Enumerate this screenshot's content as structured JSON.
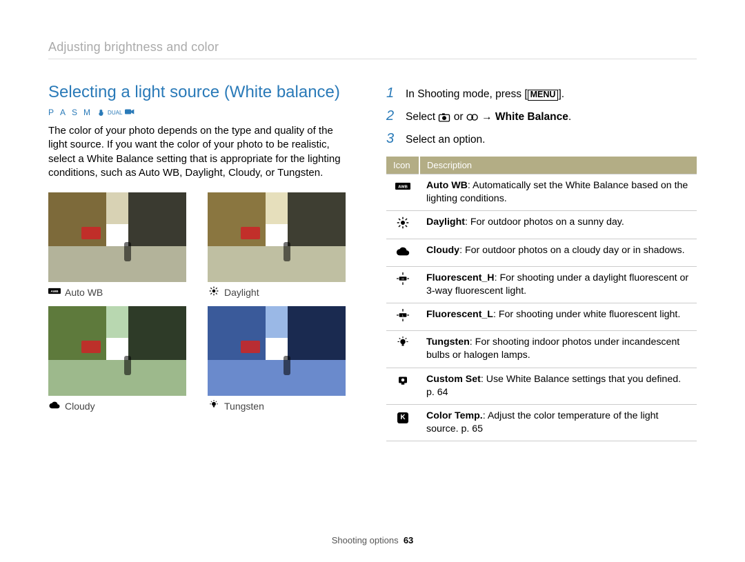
{
  "breadcrumb": "Adjusting brightness and color",
  "section_title": "Selecting a light source (White balance)",
  "modes": {
    "p": "P",
    "a": "A",
    "s": "S",
    "m": "M",
    "dual": "DUAL"
  },
  "intro": "The color of your photo depends on the type and quality of the light source. If you want the color of your photo to be realistic, select a White Balance setting that is appropriate for the lighting conditions, such as Auto WB, Daylight, Cloudy, or Tungsten.",
  "thumbs": {
    "autoWB": "Auto WB",
    "daylight": "Daylight",
    "cloudy": "Cloudy",
    "tungsten": "Tungsten"
  },
  "steps": {
    "s1_pre": "In Shooting mode, press [",
    "s1_menu": "MENU",
    "s1_post": "].",
    "s2_pre": "Select ",
    "s2_or": " or ",
    "s2_arrow": " → ",
    "s2_bold": "White Balance",
    "s2_end": ".",
    "s3": "Select an option.",
    "n1": "1",
    "n2": "2",
    "n3": "3"
  },
  "table": {
    "h_icon": "Icon",
    "h_desc": "Description",
    "rows": [
      {
        "bold": "Auto WB",
        "rest": ": Automatically set the White Balance based on the lighting conditions."
      },
      {
        "bold": "Daylight",
        "rest": ": For outdoor photos on a sunny day."
      },
      {
        "bold": "Cloudy",
        "rest": ": For outdoor photos on a cloudy day or in shadows."
      },
      {
        "bold": "Fluorescent_H",
        "rest": ": For shooting under a daylight fluorescent or 3-way fluorescent light."
      },
      {
        "bold": "Fluorescent_L",
        "rest": ": For shooting under white fluorescent light."
      },
      {
        "bold": "Tungsten",
        "rest": ": For shooting indoor photos under incandescent bulbs or halogen lamps."
      },
      {
        "bold": "Custom Set",
        "rest": ": Use White Balance settings that you defined. p. 64"
      },
      {
        "bold": "Color Temp.",
        "rest": ": Adjust the color temperature of the light source. p. 65"
      }
    ]
  },
  "footer": {
    "label": "Shooting options",
    "page": "63"
  }
}
